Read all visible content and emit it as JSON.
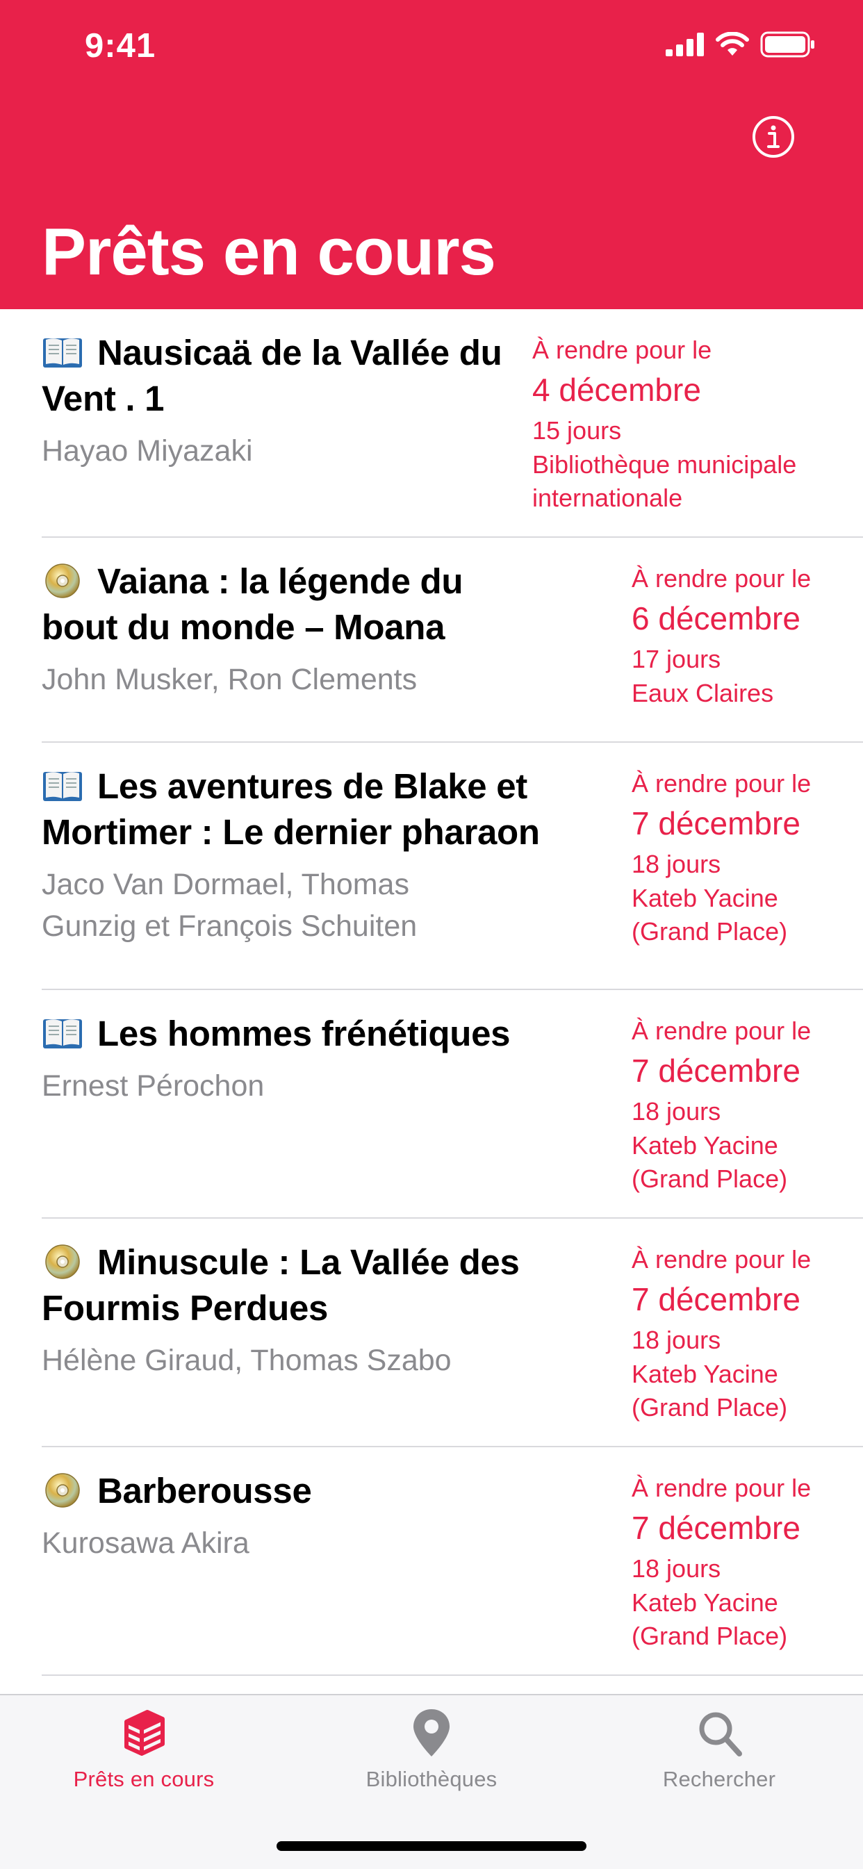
{
  "status_bar": {
    "time": "9:41"
  },
  "header": {
    "title": "Prêts en cours",
    "info_icon": "info-icon"
  },
  "colors": {
    "accent": "#E8214A",
    "secondary_text": "#8A8A8E"
  },
  "loans": [
    {
      "type_icon": "book-icon",
      "title_lines": [
        "Nausicaä de la Vallée du",
        "Vent . 1"
      ],
      "author_lines": [
        "Hayao Miyazaki"
      ],
      "due_label": "À rendre pour le",
      "due_date": "4 décembre",
      "days": "15 jours",
      "library_lines": [
        "Bibliothèque municipale",
        "internationale"
      ]
    },
    {
      "type_icon": "disc-icon",
      "title_lines": [
        "Vaiana : la légende du",
        "bout du monde – Moana"
      ],
      "author_lines": [
        "John Musker, Ron Clements"
      ],
      "due_label": "À rendre pour le",
      "due_date": "6 décembre",
      "days": "17 jours",
      "library_lines": [
        "Eaux Claires"
      ]
    },
    {
      "type_icon": "book-icon",
      "title_lines": [
        "Les aventures de Blake et",
        "Mortimer : Le dernier pharaon"
      ],
      "author_lines": [
        "Jaco Van Dormael, Thomas",
        "Gunzig et François Schuiten"
      ],
      "due_label": "À rendre pour le",
      "due_date": "7 décembre",
      "days": "18 jours",
      "library_lines": [
        "Kateb Yacine",
        "(Grand Place)"
      ]
    },
    {
      "type_icon": "book-icon",
      "title_lines": [
        "Les hommes frénétiques"
      ],
      "author_lines": [
        "Ernest Pérochon"
      ],
      "due_label": "À rendre pour le",
      "due_date": "7 décembre",
      "days": "18 jours",
      "library_lines": [
        "Kateb Yacine",
        "(Grand Place)"
      ]
    },
    {
      "type_icon": "disc-icon",
      "title_lines": [
        "Minuscule : La Vallée des",
        "Fourmis Perdues"
      ],
      "author_lines": [
        "Hélène Giraud, Thomas Szabo"
      ],
      "due_label": "À rendre pour le",
      "due_date": "7 décembre",
      "days": "18 jours",
      "library_lines": [
        "Kateb Yacine",
        "(Grand Place)"
      ]
    },
    {
      "type_icon": "disc-icon",
      "title_lines": [
        "Barberousse"
      ],
      "author_lines": [
        "Kurosawa Akira"
      ],
      "due_label": "À rendre pour le",
      "due_date": "7 décembre",
      "days": "18 jours",
      "library_lines": [
        "Kateb Yacine",
        "(Grand Place)"
      ]
    }
  ],
  "tabbar": {
    "tabs": [
      {
        "label": "Prêts en cours",
        "icon": "books-stack-icon",
        "active": true
      },
      {
        "label": "Bibliothèques",
        "icon": "map-pin-icon",
        "active": false
      },
      {
        "label": "Rechercher",
        "icon": "search-icon",
        "active": false
      }
    ]
  }
}
